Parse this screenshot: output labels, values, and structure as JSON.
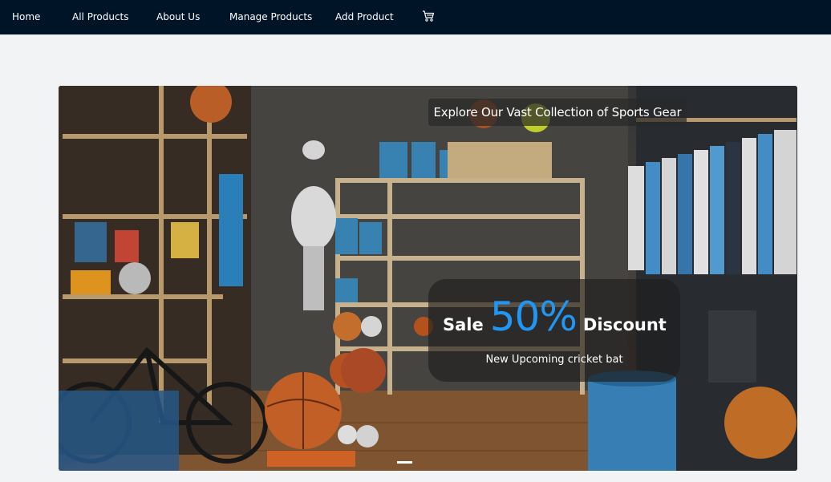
{
  "nav": {
    "items": [
      {
        "label": "Home"
      },
      {
        "label": "All Products"
      },
      {
        "label": "About Us"
      },
      {
        "label": "Manage Products"
      },
      {
        "label": "Add Product"
      }
    ],
    "cart_icon": "cart-icon"
  },
  "hero": {
    "image_description_icon": "sports-garage-image",
    "caption": "Explore Our Vast Collection of Sports Gear",
    "promo": {
      "sale": "Sale",
      "percent": "50%",
      "discount": "Discount",
      "subtitle": "New Upcoming cricket bat"
    },
    "active_slide": 1
  },
  "colors": {
    "navbar": "#001428",
    "page_bg": "#f2f3f5",
    "accent": "#2196f3"
  }
}
